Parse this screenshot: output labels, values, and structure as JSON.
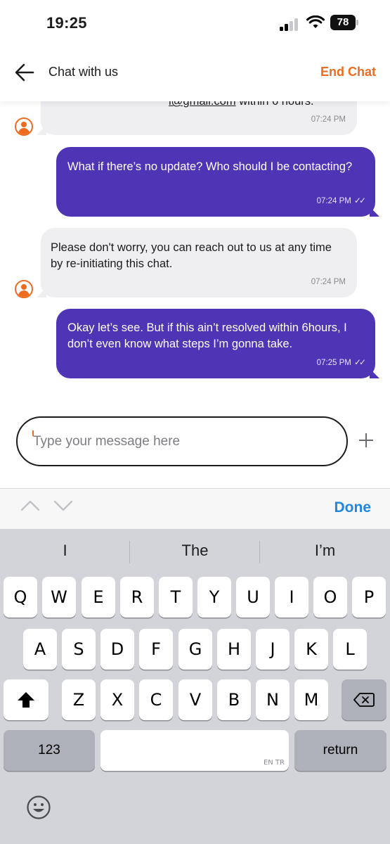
{
  "status_bar": {
    "time": "19:25",
    "battery": "78"
  },
  "header": {
    "title": "Chat with us",
    "end_chat": "End Chat"
  },
  "messages": [
    {
      "from": "agent",
      "partial_text_email": "l@gmail.com",
      "partial_text_rest": " within 6 hours.",
      "time": "07:24 PM"
    },
    {
      "from": "user",
      "text": "What if there’s no update? Who should I be contacting?",
      "time": "07:24 PM"
    },
    {
      "from": "agent",
      "text": "Please don't worry, you can reach out to us at any time by re-initiating this chat.",
      "time": "07:24 PM"
    },
    {
      "from": "user",
      "text": "Okay let’s see. But if this ain’t resolved within 6hours, I don’t even know what steps I’m gonna take.",
      "time": "07:25 PM"
    }
  ],
  "composer": {
    "placeholder": "Type your message here",
    "value": ""
  },
  "accessory": {
    "done": "Done"
  },
  "keyboard": {
    "suggestions": [
      "I",
      "The",
      "I’m"
    ],
    "row1": [
      "Q",
      "W",
      "E",
      "R",
      "T",
      "Y",
      "U",
      "I",
      "O",
      "P"
    ],
    "row2": [
      "A",
      "S",
      "D",
      "F",
      "G",
      "H",
      "J",
      "K",
      "L"
    ],
    "row3": [
      "Z",
      "X",
      "C",
      "V",
      "B",
      "N",
      "M"
    ],
    "numbers_key": "123",
    "space_lang": "EN TR",
    "return_key": "return"
  },
  "colors": {
    "accent_orange": "#ef6b1f",
    "user_bubble": "#4f34b5",
    "agent_bubble": "#efeff2",
    "done_blue": "#1f87e0"
  },
  "icons": [
    "back-arrow-icon",
    "agent-avatar-icon",
    "double-check-icon",
    "plus-icon",
    "chevron-up-icon",
    "chevron-down-icon",
    "shift-icon",
    "delete-icon",
    "emoji-icon"
  ]
}
